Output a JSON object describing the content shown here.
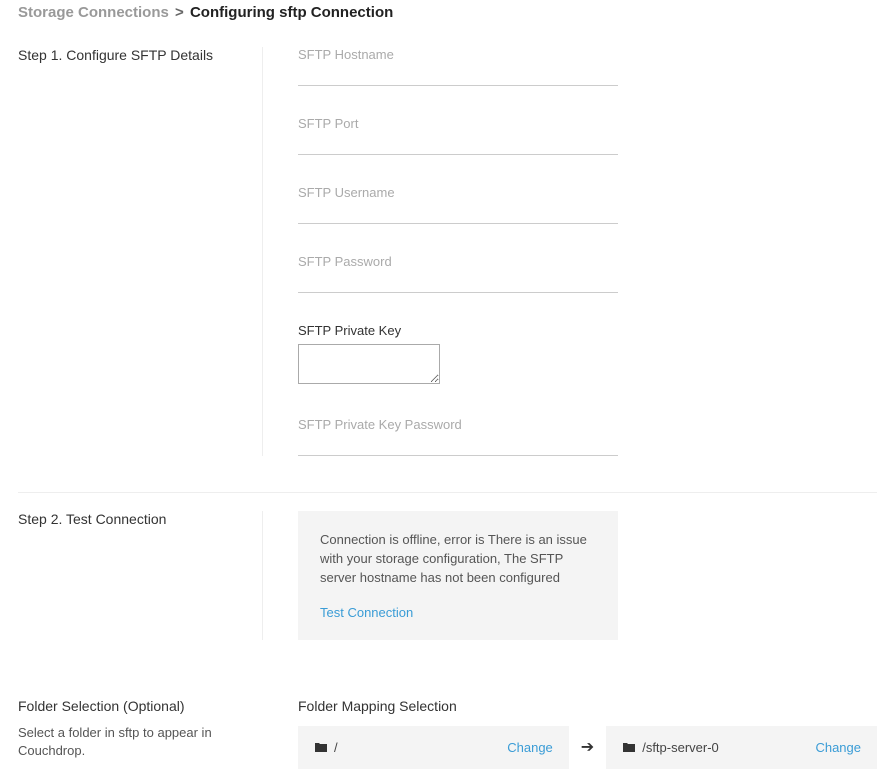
{
  "breadcrumb": {
    "root": "Storage Connections",
    "separator": ">",
    "current": "Configuring sftp Connection"
  },
  "step1": {
    "title": "Step 1. Configure SFTP Details",
    "fields": {
      "hostname_label": "SFTP Hostname",
      "port_label": "SFTP Port",
      "username_label": "SFTP Username",
      "password_label": "SFTP Password",
      "private_key_label": "SFTP Private Key",
      "private_key_password_label": "SFTP Private Key Password"
    }
  },
  "step2": {
    "title": "Step 2. Test Connection",
    "status_message": "Connection is offline, error is There is an issue with your storage configuration, The SFTP server hostname has not been configured",
    "test_button": "Test Connection"
  },
  "folder": {
    "title": "Folder Selection (Optional)",
    "description": "Select a folder in sftp to appear in Couchdrop.",
    "mapping_title": "Folder Mapping Selection",
    "source_path": "/",
    "dest_path": "/sftp-server-0",
    "change_label": "Change"
  }
}
